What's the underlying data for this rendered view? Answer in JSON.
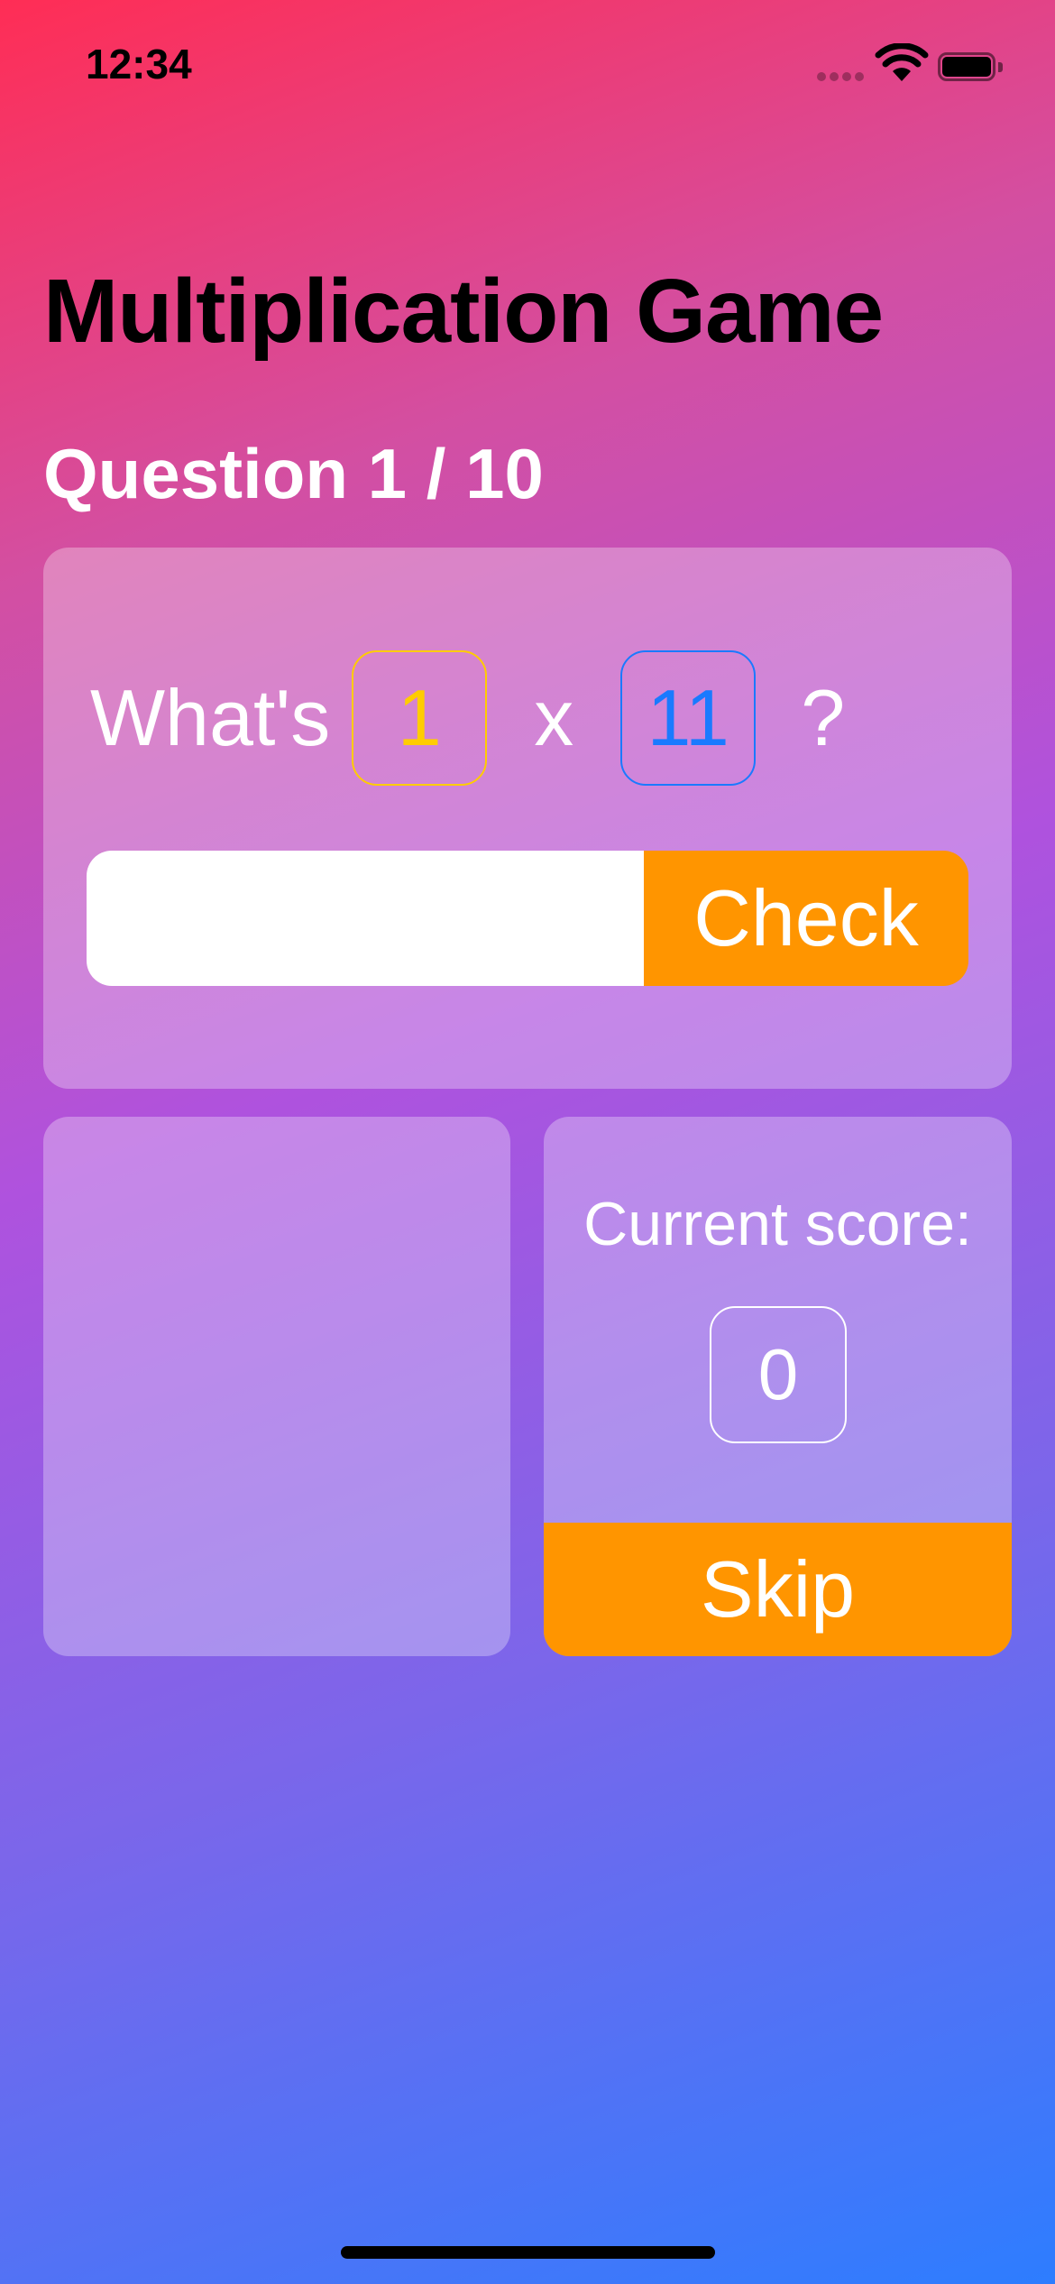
{
  "status_bar": {
    "time": "12:34",
    "signal_icon": "cellular-signal-icon",
    "wifi_icon": "wifi-icon",
    "battery_icon": "battery-icon"
  },
  "header": {
    "title": "Multiplication Game",
    "question_counter": "Question 1 / 10"
  },
  "question": {
    "prefix": "What's",
    "left_operand": "1",
    "operator": "x",
    "right_operand": "11",
    "suffix": "?"
  },
  "answer": {
    "value": "",
    "placeholder": "",
    "check_label": "Check"
  },
  "score": {
    "label": "Current score:",
    "value": "0",
    "skip_label": "Skip"
  },
  "colors": {
    "accent_orange": "#ff9500",
    "left_operand_color": "#ffcc00",
    "right_operand_color": "#1a7aff",
    "gradient_start": "#ff2d55",
    "gradient_end": "#2d7dff"
  }
}
